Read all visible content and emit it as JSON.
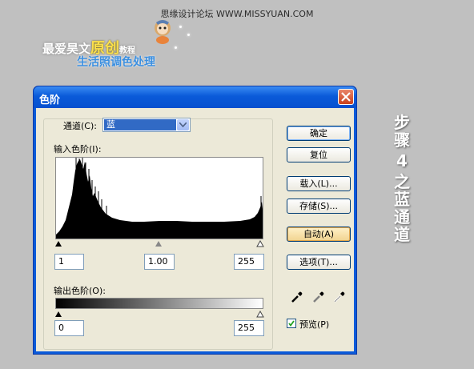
{
  "page": {
    "watermark": "思缘设计论坛 WWW.MISSYUAN.COM",
    "logo": {
      "line1_prefix": "最爱昊文",
      "line1_highlight": "原创",
      "line1_suffix": "教程",
      "line2": "生活照调色处理"
    },
    "side_title": [
      "步",
      "骤",
      "4",
      "之",
      "蓝",
      "通",
      "道"
    ]
  },
  "dialog": {
    "title": "色阶",
    "channel_label": "通道(C):",
    "channel_value": "蓝",
    "input_levels_label": "输入色阶(I):",
    "input_black": "1",
    "input_gamma": "1.00",
    "input_white": "255",
    "output_levels_label": "输出色阶(O):",
    "output_black": "0",
    "output_white": "255",
    "buttons": {
      "ok": "确定",
      "reset": "复位",
      "load": "载入(L)...",
      "save": "存储(S)...",
      "auto": "自动(A)",
      "options": "选项(T)..."
    },
    "preview_label": "预览(P)",
    "preview_checked": true
  },
  "colors": {
    "titlebar": "#0a5ad9",
    "client": "#ece9d8",
    "select_highlight": "#316ac5"
  },
  "icons": [
    "close-icon",
    "dropdown-arrow-icon",
    "black-eyedropper-icon",
    "gray-eyedropper-icon",
    "white-eyedropper-icon",
    "checkmark-icon"
  ]
}
